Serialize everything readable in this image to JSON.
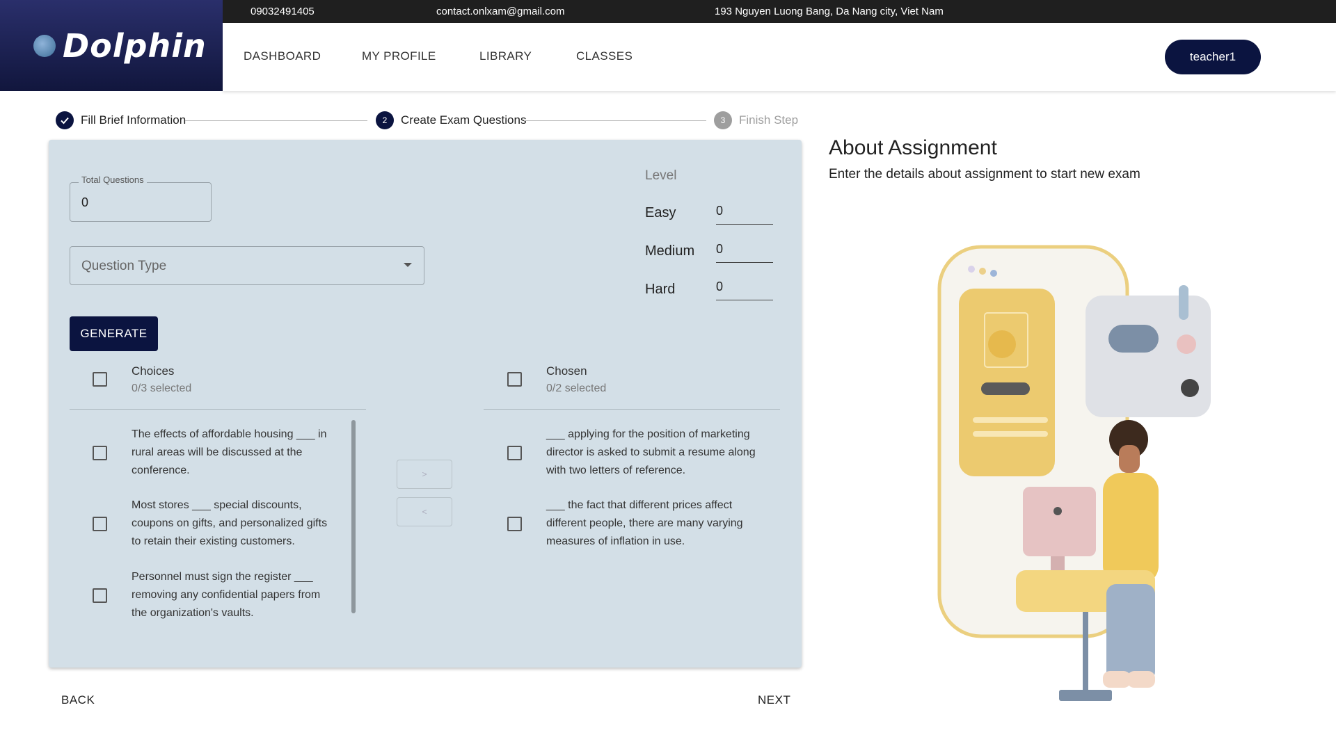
{
  "contact": {
    "phone": "09032491405",
    "email": "contact.onlxam@gmail.com",
    "address": "193 Nguyen Luong Bang, Da Nang city, Viet Nam"
  },
  "brand": {
    "name": "Dolphin"
  },
  "nav": {
    "dashboard": "DASHBOARD",
    "profile": "MY PROFILE",
    "library": "LIBRARY",
    "classes": "CLASSES",
    "user": "teacher1"
  },
  "stepper": {
    "step1": "Fill Brief Information",
    "step2_num": "2",
    "step2": "Create Exam Questions",
    "step3_num": "3",
    "step3": "Finish Step"
  },
  "form": {
    "total_questions_label": "Total Questions",
    "total_questions_value": "0",
    "question_type_placeholder": "Question Type",
    "generate_label": "GENERATE",
    "level_label": "Level",
    "easy_label": "Easy",
    "easy_value": "0",
    "medium_label": "Medium",
    "medium_value": "0",
    "hard_label": "Hard",
    "hard_value": "0"
  },
  "choices": {
    "title": "Choices",
    "selected": "0/3 selected",
    "items": [
      "The effects of affordable housing ___ in rural areas will be discussed at the conference.",
      "Most stores ___ special discounts, coupons on gifts, and personalized gifts to retain their existing customers.",
      "Personnel must sign the register ___ removing any confidential papers from the organization's vaults."
    ]
  },
  "transfer": {
    "right": ">",
    "left": "<"
  },
  "chosen": {
    "title": "Chosen",
    "selected": "0/2 selected",
    "items": [
      "___ applying for the position of marketing director is asked to submit a resume along with two letters of reference.",
      "___ the fact that different prices affect different people, there are many varying measures of inflation in use."
    ]
  },
  "footer": {
    "back": "BACK",
    "next": "NEXT"
  },
  "about": {
    "title": "About Assignment",
    "subtitle": "Enter the details about assignment to start new exam"
  },
  "colors": {
    "navy": "#0b1440",
    "card": "#d3dfe7",
    "topbar": "#1f1f1f"
  }
}
